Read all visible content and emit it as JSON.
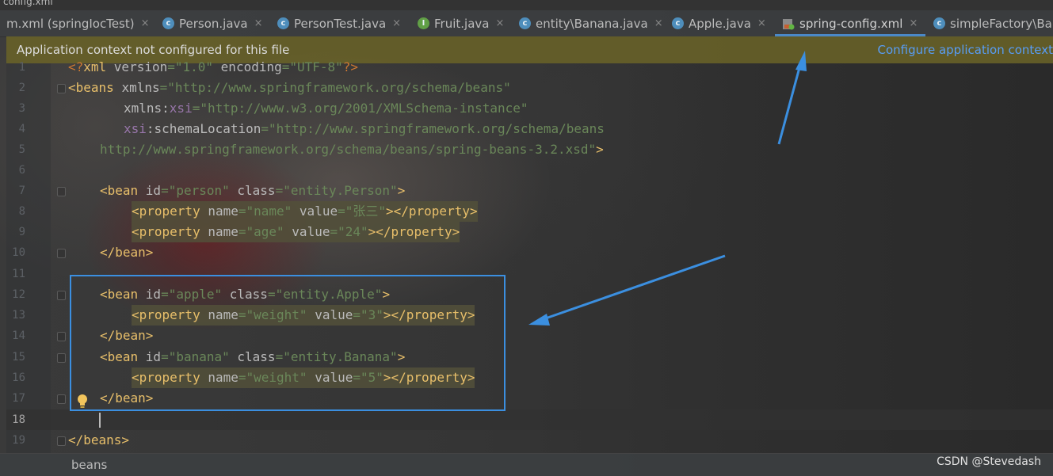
{
  "window": {
    "title_fragment": "config.xml"
  },
  "tabs": [
    {
      "label": "m.xml (springIocTest)",
      "icon": "maven-xml-icon"
    },
    {
      "label": "Person.java",
      "icon": "class-icon"
    },
    {
      "label": "PersonTest.java",
      "icon": "test-class-icon"
    },
    {
      "label": "Fruit.java",
      "icon": "interface-icon"
    },
    {
      "label": "entity\\Banana.java",
      "icon": "class-icon"
    },
    {
      "label": "Apple.java",
      "icon": "class-icon"
    },
    {
      "label": "spring-config.xml",
      "icon": "spring-xml-icon",
      "active": true
    },
    {
      "label": "simpleFactory\\Banana.java",
      "icon": "class-icon"
    }
  ],
  "class_icon_letter": "c",
  "interface_icon_letter": "I",
  "close_glyph": "×",
  "banner": {
    "message": "Application context not configured for this file",
    "action": "Configure application context"
  },
  "editor": {
    "line_numbers": [
      "1",
      "2",
      "3",
      "4",
      "5",
      "6",
      "7",
      "8",
      "9",
      "10",
      "11",
      "12",
      "13",
      "14",
      "15",
      "16",
      "17",
      "18",
      "19"
    ],
    "current_line": 18
  },
  "breadcrumb": "beans",
  "watermark": "CSDN @Stevedash",
  "colors": {
    "tag": "#e8bf6a",
    "attr": "#bababa",
    "string": "#6a8759",
    "namespace": "#9876aa",
    "annotation_arrow": "#3b8fe0"
  }
}
